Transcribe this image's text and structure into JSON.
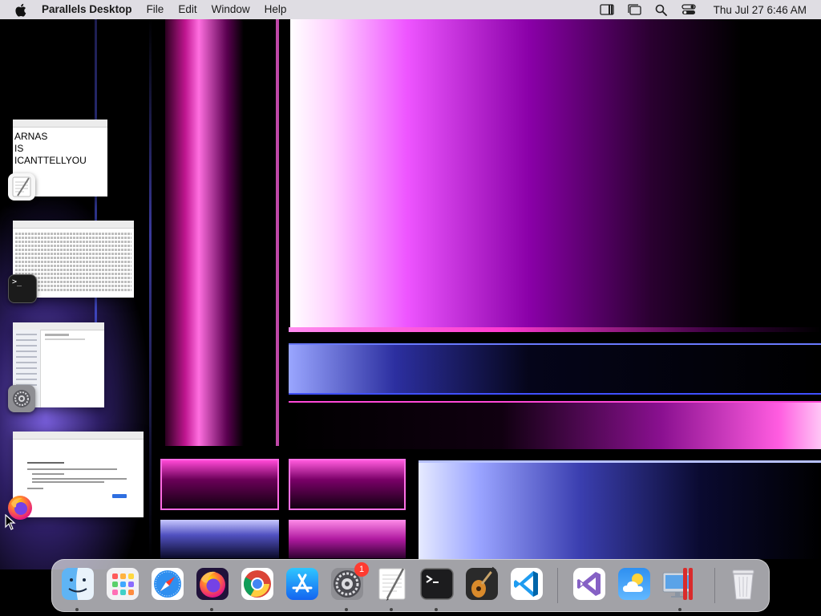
{
  "menubar": {
    "app_name": "Parallels Desktop",
    "items": [
      "File",
      "Edit",
      "Window",
      "Help"
    ],
    "clock": "Thu Jul 27  6:46 AM",
    "status_icons": [
      "parallels-menu-icon",
      "stage-manager-icon",
      "spotlight-search-icon",
      "control-center-icon"
    ]
  },
  "stage_manager": {
    "windows": [
      {
        "app": "TextEdit",
        "icon": "textedit-icon",
        "content_lines": [
          "ARNAS",
          "IS",
          "ICANTTELLYOU"
        ]
      },
      {
        "app": "Terminal",
        "icon": "terminal-icon"
      },
      {
        "app": "System Settings",
        "icon": "system-settings-icon"
      },
      {
        "app": "Firefox",
        "icon": "firefox-icon"
      }
    ]
  },
  "dock": {
    "apps": [
      {
        "name": "Finder",
        "icon": "finder-icon",
        "running": true
      },
      {
        "name": "Launchpad",
        "icon": "launchpad-icon",
        "running": false
      },
      {
        "name": "Safari",
        "icon": "safari-icon",
        "running": false
      },
      {
        "name": "Firefox",
        "icon": "firefox-icon",
        "running": true
      },
      {
        "name": "Google Chrome",
        "icon": "chrome-icon",
        "running": false
      },
      {
        "name": "App Store",
        "icon": "app-store-icon",
        "running": false
      },
      {
        "name": "System Settings",
        "icon": "system-settings-icon",
        "running": true,
        "badge": "1"
      },
      {
        "name": "TextEdit",
        "icon": "textedit-icon",
        "running": true
      },
      {
        "name": "Terminal",
        "icon": "terminal-icon",
        "running": true
      },
      {
        "name": "GarageBand",
        "icon": "garageband-icon",
        "running": false
      },
      {
        "name": "Visual Studio Code",
        "icon": "vscode-icon",
        "running": false
      },
      {
        "name": "Visual Studio",
        "icon": "visual-studio-icon",
        "running": false
      },
      {
        "name": "Weather",
        "icon": "weather-icon",
        "running": false
      },
      {
        "name": "Parallels Desktop",
        "icon": "parallels-desktop-icon",
        "running": true
      },
      {
        "name": "Trash",
        "icon": "trash-icon",
        "running": false
      }
    ]
  }
}
